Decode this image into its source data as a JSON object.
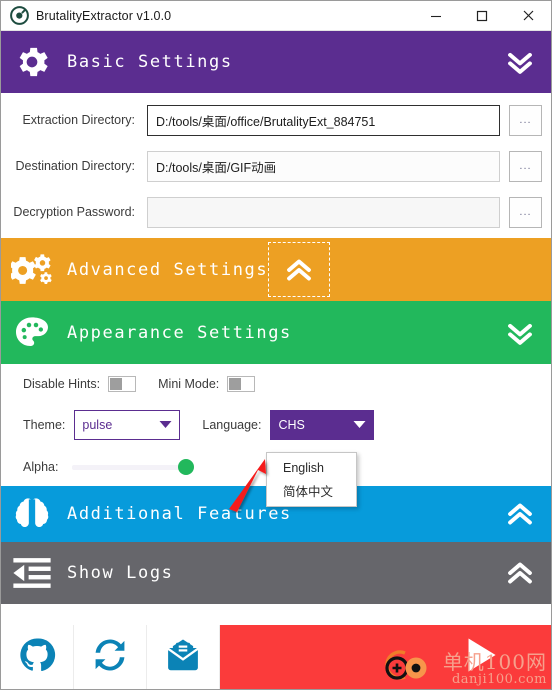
{
  "window": {
    "title": "BrutalityExtractor v1.0.0",
    "logo_icon": "at-circle-icon",
    "minimize_label": "─",
    "maximize_label": "□",
    "close_label": "✕"
  },
  "colors": {
    "basic": "#5b2d90",
    "advanced": "#eda023",
    "appearance": "#22b85c",
    "additional": "#079bdb",
    "logs": "#66666b",
    "toolbar": "#fb3b3b",
    "toolbar_icon": "#0b83b6",
    "slider_knob": "#22b85c",
    "watermark": "#f6a08c"
  },
  "sections": {
    "basic": {
      "title": "Basic Settings",
      "icon": "gear-icon",
      "chevron": "chevron-double-down-icon",
      "expanded": true
    },
    "advanced": {
      "title": "Advanced Settings",
      "icon": "gears-icon",
      "chevron": "chevron-double-up-icon",
      "expanded": false
    },
    "appearance": {
      "title": "Appearance Settings",
      "icon": "palette-icon",
      "chevron": "chevron-double-down-icon",
      "expanded": true
    },
    "additional": {
      "title": "Additional Features",
      "icon": "brain-icon",
      "chevron": "chevron-double-up-icon",
      "expanded": false
    },
    "logs": {
      "title": "Show Logs",
      "icon": "indent-list-icon",
      "chevron": "chevron-double-up-icon",
      "expanded": false
    }
  },
  "basic_form": {
    "extraction": {
      "label": "Extraction Directory:",
      "value": "D:/tools/桌面/office/BrutalityExt_884751",
      "browse_label": "..."
    },
    "destination": {
      "label": "Destination Directory:",
      "value": "D:/tools/桌面/GIF动画",
      "browse_label": "..."
    },
    "password": {
      "label": "Decryption Password:",
      "value": "",
      "placeholder": "",
      "browse_label": "..."
    }
  },
  "appearance_form": {
    "disable_hints": {
      "label": "Disable Hints:",
      "checked": false
    },
    "mini_mode": {
      "label": "Mini Mode:",
      "checked": false
    },
    "theme": {
      "label": "Theme:",
      "value": "pulse"
    },
    "language": {
      "label": "Language:",
      "value": "CHS"
    },
    "alpha": {
      "label": "Alpha:",
      "value": 100
    }
  },
  "language_dropdown": {
    "open": true,
    "options": [
      "English",
      "简体中文"
    ]
  },
  "toolbar": {
    "github": "github-icon",
    "refresh": "sync-refresh-icon",
    "mail": "envelope-open-text-icon",
    "run": "play-icon"
  },
  "watermark": {
    "line1": "单机100网",
    "line2": "danji100.com"
  }
}
